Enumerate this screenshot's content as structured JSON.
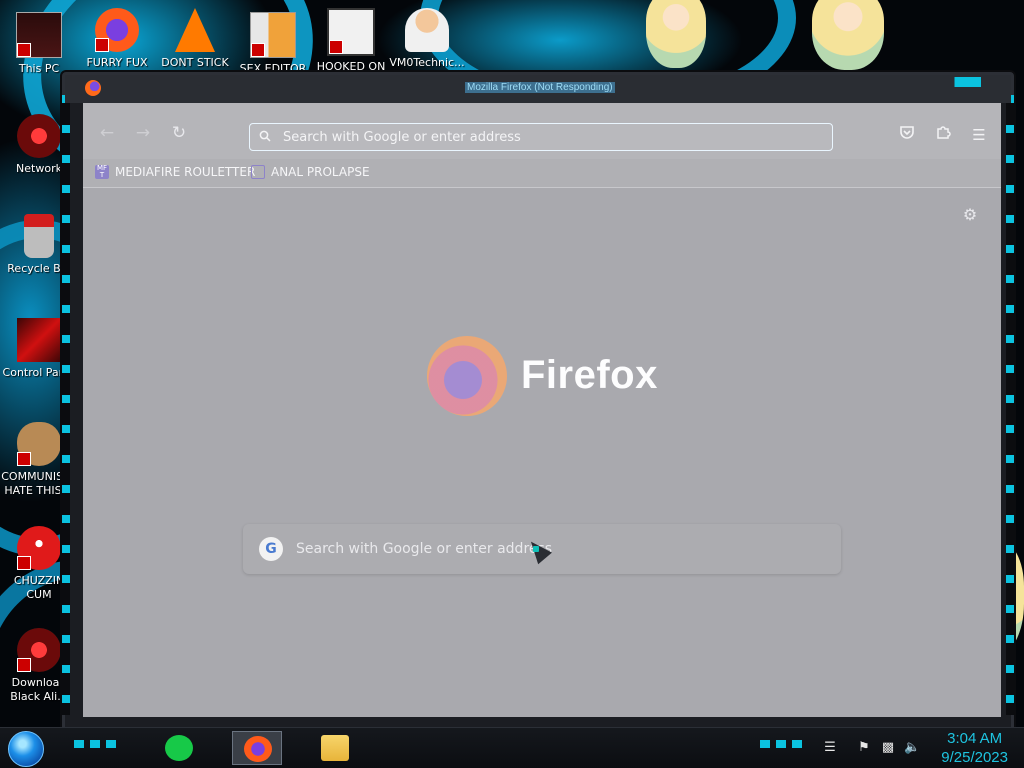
{
  "desktop": {
    "top_icons": [
      {
        "label": "This PC"
      },
      {
        "label": "FURRY FUX"
      },
      {
        "label": "DONT STICK"
      },
      {
        "label": "SEX EDITOR"
      },
      {
        "label": "HOOKED ON"
      },
      {
        "label": "VM0Technic..."
      }
    ],
    "left_icons": [
      {
        "label": "Network"
      },
      {
        "label": "Recycle Bin"
      },
      {
        "label": "Control Panel"
      },
      {
        "label": "COMMUNISTS HATE THIS G"
      },
      {
        "label": "CHUZZIN CUM"
      },
      {
        "label": "Download Black Ali..."
      }
    ]
  },
  "window": {
    "title": "Mozilla Firefox (Not Responding)"
  },
  "browser": {
    "urlbar_placeholder": "Search with Google or enter address",
    "bookmarks": [
      {
        "label": "MEDIAFIRE ROULETTER",
        "icon_text": "MF T"
      },
      {
        "label": "ANAL PROLAPSE",
        "icon_text": ""
      }
    ],
    "newtab": {
      "brand": "Firefox",
      "search_placeholder": "Search with Google or enter address"
    }
  },
  "taskbar": {
    "time": "3:04 AM",
    "date": "9/25/2023",
    "apps": [
      {
        "name": "notes-app",
        "color": "#17c948"
      },
      {
        "name": "firefox",
        "color": "#ff7a1a"
      },
      {
        "name": "file-explorer",
        "color": "#f3c640"
      }
    ]
  },
  "colors": {
    "accent": "#0bc3e0",
    "title_text": "#9edcf6",
    "clock": "#1ec4e0"
  }
}
